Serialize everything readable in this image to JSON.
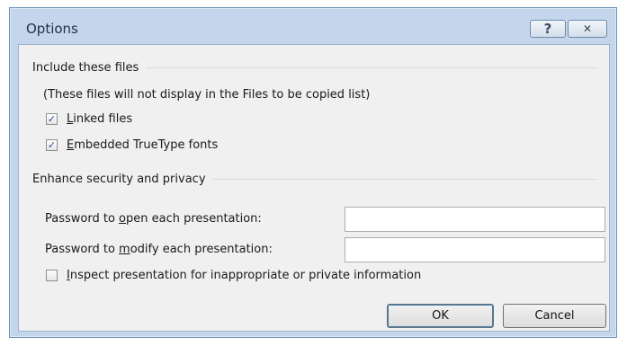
{
  "window": {
    "title": "Options",
    "help_glyph": "?",
    "close_glyph": "✕"
  },
  "include_group": {
    "title": "Include these files",
    "note": "(These files will not display in the Files to be copied list)",
    "linked_files": {
      "mnemonic": "L",
      "rest": "inked files",
      "checked": true
    },
    "embedded_fonts": {
      "mnemonic": "E",
      "rest": "mbedded TrueType fonts",
      "checked": true
    }
  },
  "security_group": {
    "title": "Enhance security and privacy",
    "open_password": {
      "prefix": "Password to ",
      "mnemonic": "o",
      "rest": "pen each presentation:",
      "value": ""
    },
    "modify_password": {
      "prefix": "Password to ",
      "mnemonic": "m",
      "rest": "odify each presentation:",
      "value": ""
    },
    "inspect": {
      "mnemonic": "I",
      "rest": "nspect presentation for inappropriate or private information",
      "checked": false
    }
  },
  "buttons": {
    "ok": "OK",
    "cancel": "Cancel"
  },
  "check_glyph": "✓",
  "colors": {
    "accent": "#3c7fb1",
    "frame": "#c3d6ec",
    "client": "#f0f0f0"
  }
}
